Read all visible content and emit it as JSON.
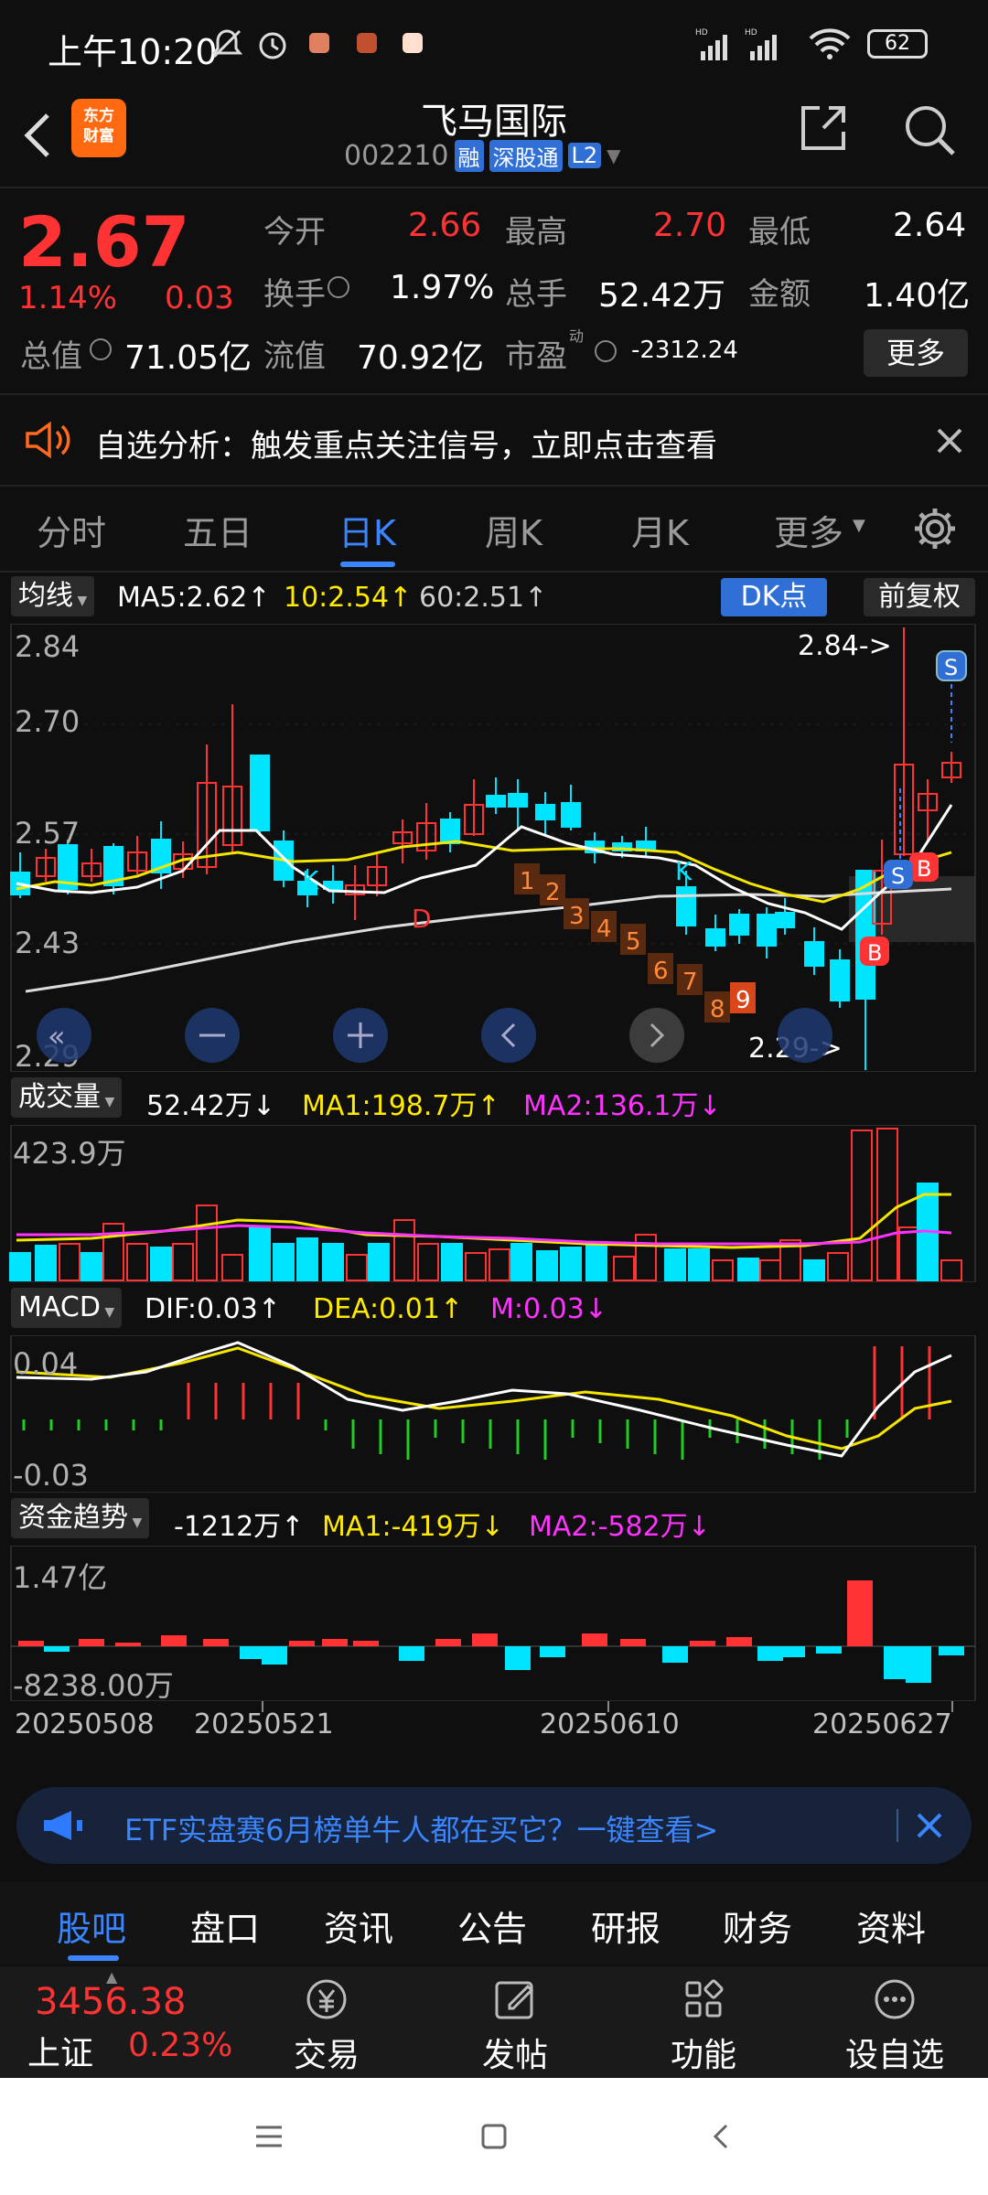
{
  "status_bar": {
    "time": "上午10:20",
    "battery": "62",
    "network": "HD"
  },
  "header": {
    "title": "飞马国际",
    "code": "002210",
    "tags": [
      "融",
      "深股通",
      "L2"
    ],
    "logo_text": "东方\n财富"
  },
  "quote": {
    "price": "2.67",
    "pct": "1.14%",
    "change": "0.03",
    "row1": [
      {
        "label": "今开",
        "value": "2.66",
        "color": "red"
      },
      {
        "label": "最高",
        "value": "2.70",
        "color": "red"
      },
      {
        "label": "最低",
        "value": "2.64",
        "color": "white"
      }
    ],
    "row2": [
      {
        "label": "换手",
        "value": "1.97%"
      },
      {
        "label": "总手",
        "value": "52.42万"
      },
      {
        "label": "金额",
        "value": "1.40亿"
      }
    ],
    "row3": [
      {
        "label": "总值",
        "value": "71.05亿"
      },
      {
        "label": "流值",
        "value": "70.92亿"
      },
      {
        "label": "市盈",
        "sup": "动",
        "value": "-2312.24"
      }
    ],
    "more_btn": "更多"
  },
  "notice": {
    "text": "自选分析：触发重点关注信号，立即点击查看"
  },
  "tabs": {
    "items": [
      "分时",
      "五日",
      "日K",
      "周K",
      "月K",
      "更多"
    ],
    "active": 2
  },
  "ma_bar": {
    "selector": "均线",
    "ma5": "MA5:2.62↑",
    "ma10": "10:2.54↑",
    "ma60": "60:2.51↑",
    "dk": "DK点",
    "fq": "前复权"
  },
  "kchart": {
    "y_labels": [
      "2.84",
      "2.70",
      "2.57",
      "2.43",
      "2.29"
    ],
    "high_label": "2.84->",
    "low_label": "2.29->",
    "markers": [
      "K",
      "D",
      "K",
      "1",
      "2",
      "3",
      "4",
      "5",
      "6",
      "7",
      "8",
      "9",
      "S",
      "B",
      "S",
      "B",
      "B"
    ]
  },
  "volume": {
    "selector": "成交量",
    "value": "52.42万↓",
    "ma1": "MA1:198.7万↑",
    "ma2": "MA2:136.1万↓",
    "ymax": "423.9万"
  },
  "macd": {
    "selector": "MACD",
    "dif": "DIF:0.03↑",
    "dea": "DEA:0.01↑",
    "m": "M:0.03↓",
    "ytop": "0.04",
    "ybot": "-0.03"
  },
  "fund": {
    "selector": "资金趋势",
    "value": "-1212万↑",
    "ma1": "MA1:-419万↓",
    "ma2": "MA2:-582万↓",
    "ytop": "1.47亿",
    "ybot": "-8238.00万"
  },
  "x_dates": [
    "20250508",
    "20250521",
    "20250610",
    "20250627"
  ],
  "ad": {
    "text": "ETF实盘赛6月榜单牛人都在买它？一键查看>"
  },
  "sub_tabs": {
    "items": [
      "股吧",
      "盘口",
      "资讯",
      "公告",
      "研报",
      "财务",
      "资料"
    ],
    "active": 0
  },
  "bottom": {
    "index_value": "3456.38",
    "index_name": "上证",
    "index_pct": "0.23%",
    "actions": [
      "交易",
      "发帖",
      "功能",
      "设自选"
    ]
  },
  "colors": {
    "up": "#ff3333",
    "down": "#00e5ff",
    "accent": "#2f7bff",
    "bg": "#0f0f0f"
  }
}
